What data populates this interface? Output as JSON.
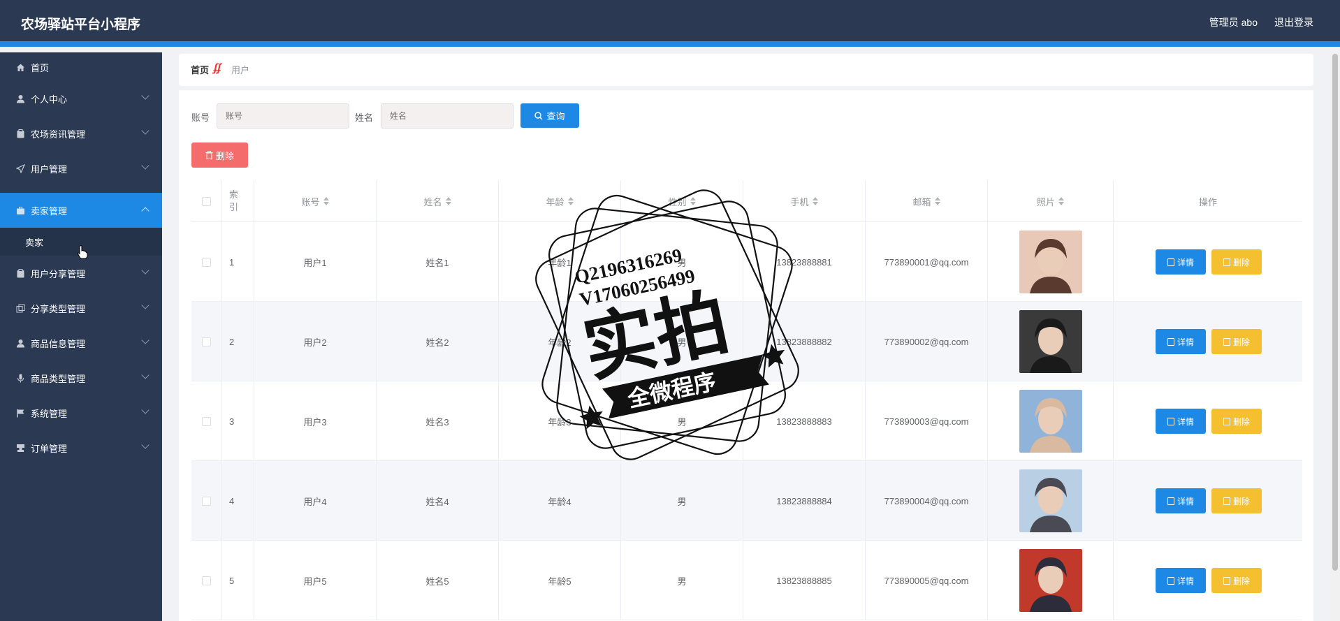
{
  "header": {
    "title": "农场驿站平台小程序",
    "admin": "管理员 abo",
    "logout": "退出登录"
  },
  "sidebar": {
    "items": [
      {
        "label": "首页",
        "icon": "home-icon"
      },
      {
        "label": "个人中心",
        "icon": "user-icon"
      },
      {
        "label": "农场资讯管理",
        "icon": "clipboard-icon"
      },
      {
        "label": "用户管理",
        "icon": "send-icon"
      },
      {
        "label": "卖家管理",
        "icon": "briefcase-icon"
      },
      {
        "label": "用户分享管理",
        "icon": "clipboard-icon"
      },
      {
        "label": "分享类型管理",
        "icon": "copy-icon"
      },
      {
        "label": "商品信息管理",
        "icon": "user-icon"
      },
      {
        "label": "商品类型管理",
        "icon": "mic-icon"
      },
      {
        "label": "系统管理",
        "icon": "flag-icon"
      },
      {
        "label": "订单管理",
        "icon": "stamp-icon"
      }
    ],
    "sub_item": "卖家"
  },
  "breadcrumb": {
    "home": "首页",
    "current": "用户"
  },
  "search": {
    "account_label": "账号",
    "account_placeholder": "账号",
    "name_label": "姓名",
    "name_placeholder": "姓名",
    "query_button": "查询"
  },
  "toolbar": {
    "delete_button": "删除"
  },
  "table": {
    "headers": [
      "索引",
      "账号",
      "姓名",
      "年龄",
      "性别",
      "手机",
      "邮箱",
      "照片",
      "操作"
    ],
    "rows": [
      {
        "index": "1",
        "account": "用户1",
        "name": "姓名1",
        "age": "年龄1",
        "gender": "男",
        "phone": "13823888881",
        "email": "773890001@qq.com"
      },
      {
        "index": "2",
        "account": "用户2",
        "name": "姓名2",
        "age": "年龄2",
        "gender": "男",
        "phone": "13823888882",
        "email": "773890002@qq.com"
      },
      {
        "index": "3",
        "account": "用户3",
        "name": "姓名3",
        "age": "年龄3",
        "gender": "男",
        "phone": "13823888883",
        "email": "773890003@qq.com"
      },
      {
        "index": "4",
        "account": "用户4",
        "name": "姓名4",
        "age": "年龄4",
        "gender": "男",
        "phone": "13823888884",
        "email": "773890004@qq.com"
      },
      {
        "index": "5",
        "account": "用户5",
        "name": "姓名5",
        "age": "年龄5",
        "gender": "男",
        "phone": "13823888885",
        "email": "773890005@qq.com"
      }
    ],
    "detail_button": "详情",
    "delete_button": "删除"
  },
  "watermark": {
    "line1": "Q2196316269",
    "line2": "V17060256499",
    "big": "实拍",
    "ribbon": "全微程序"
  },
  "colors": {
    "header_bg": "#2b3a52",
    "accent": "#1e88e5",
    "danger": "#f56c6c",
    "warning": "#f4c02f"
  }
}
